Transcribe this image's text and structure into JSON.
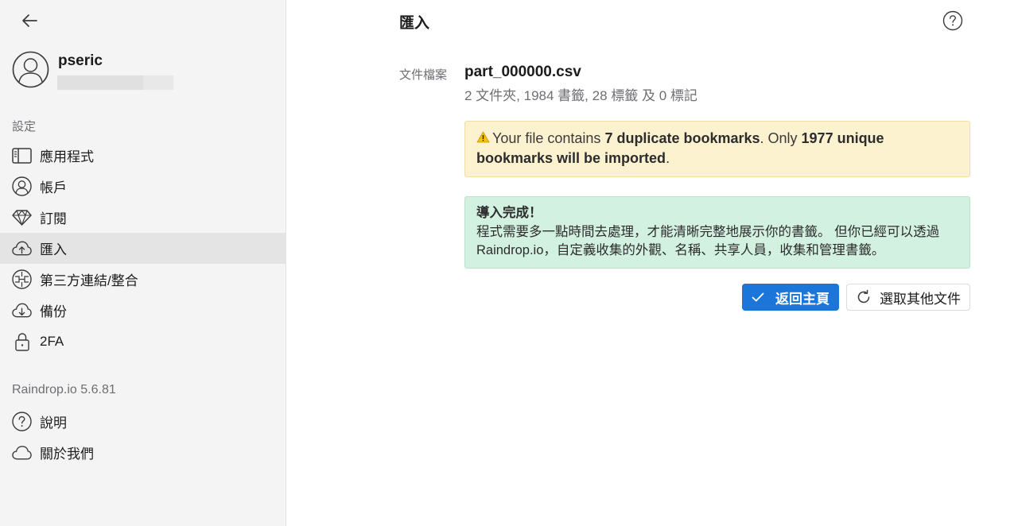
{
  "sidebar": {
    "profile": {
      "username": "pseric"
    },
    "settings_label": "設定",
    "items": [
      {
        "label": "應用程式",
        "icon": "sidebar-layout-icon"
      },
      {
        "label": "帳戶",
        "icon": "user-icon"
      },
      {
        "label": "訂閱",
        "icon": "diamond-icon"
      },
      {
        "label": "匯入",
        "icon": "cloud-upload-icon"
      },
      {
        "label": "第三方連結/整合",
        "icon": "integration-icon"
      },
      {
        "label": "備份",
        "icon": "cloud-download-icon"
      },
      {
        "label": "2FA",
        "icon": "lock-icon"
      }
    ],
    "version_label": "Raindrop.io 5.6.81",
    "help_items": [
      {
        "label": "說明",
        "icon": "help-icon"
      },
      {
        "label": "關於我們",
        "icon": "cloud-icon"
      }
    ]
  },
  "main": {
    "title": "匯入",
    "file_label": "文件檔案",
    "file_name": "part_000000.csv",
    "file_stats": "2 文件夾, 1984 書籤, 28 標籤 及 0 標記",
    "warning": {
      "prefix": "Your file contains ",
      "duplicates": "7 duplicate bookmarks",
      "middle": ". Only ",
      "unique": "1977 unique bookmarks will be imported",
      "suffix": "."
    },
    "success": {
      "title": "導入完成！",
      "body": "程式需要多一點時間去處理，才能清晰完整地展示你的書籤。 但你已經可以透過 Raindrop.io，自定義收集的外觀、名稱、共享人員，收集和管理書籤。"
    },
    "primary_button": "返回主頁",
    "secondary_button": "選取其他文件"
  },
  "colors": {
    "accent": "#1a76d9",
    "warning_bg": "#fdf2cf",
    "success_bg": "#d3f1e0",
    "sidebar_bg": "#f4f4f4",
    "active_item_bg": "#e4e4e4"
  }
}
